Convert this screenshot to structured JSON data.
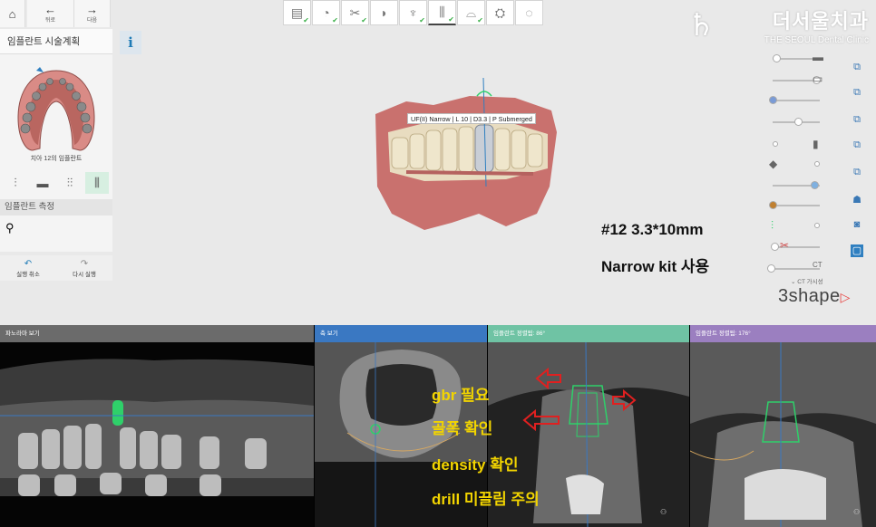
{
  "nav": {
    "home_icon": "home-icon",
    "back_label": "뒤로",
    "next_label": "다음"
  },
  "workflow_steps": [
    {
      "icon": "scan-import-icon",
      "done": true
    },
    {
      "icon": "alignment-icon",
      "done": true
    },
    {
      "icon": "tools-icon",
      "done": true
    },
    {
      "icon": "tooth-crown-icon",
      "done": false
    },
    {
      "icon": "tooth-setup-icon",
      "done": true
    },
    {
      "icon": "implant-icon",
      "done": true,
      "active": true
    },
    {
      "icon": "guide-icon",
      "done": true
    },
    {
      "icon": "guide-design-icon",
      "done": false
    },
    {
      "icon": "export-icon",
      "done": false
    }
  ],
  "brand": {
    "name": "더서울치과",
    "subtitle": "THE SEOUL Dental Clinic"
  },
  "left_panel": {
    "title": "임플란트 시술계획",
    "info_label": "i",
    "caption": "치아 12의 임플란트",
    "section_label": "임플란트 측정",
    "undo_label": "실행 취소",
    "redo_label": "다시 실행"
  },
  "viewport": {
    "implant_tooltip": "UF(II) Narrow | L 10 | D3.3 | P Submerged",
    "note_line1": "#12 3.3*10mm",
    "note_line2": "Narrow kit 사용"
  },
  "right_panel": {
    "ct_toggle_label": "CT 가시성",
    "logo_text": "3shape"
  },
  "views": [
    {
      "title": "파노라마 보기",
      "color": "#6b6b6b"
    },
    {
      "title": "축 보기",
      "color": "#3a78c2"
    },
    {
      "title": "임플란트 정렬됨: 86°",
      "color": "#6fc3a4"
    },
    {
      "title": "임플란트 정렬됨: 176°",
      "color": "#9b7fc0"
    }
  ],
  "annotations": {
    "line1": "gbr 필요",
    "line2": "골폭 확인",
    "line3": "density 확인",
    "line4": "drill 미끌림 주의"
  },
  "colors": {
    "accent_blue": "#2f7fc0",
    "annotation_yellow": "#f2d400",
    "arrow_red": "#e02020",
    "implant_green": "#2fd06a"
  }
}
